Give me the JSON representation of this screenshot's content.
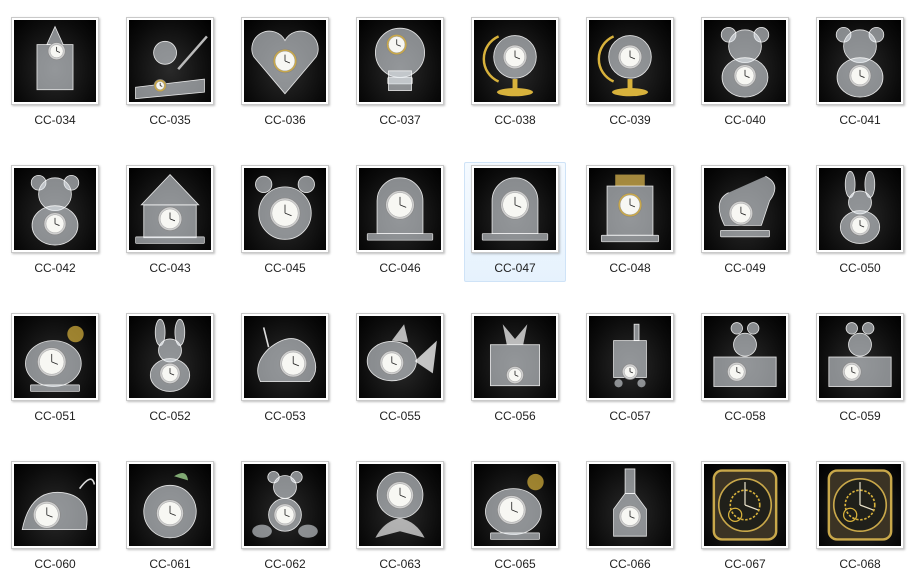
{
  "items": [
    {
      "label": "CC-034",
      "icon": "star-crystal-clock"
    },
    {
      "label": "CC-035",
      "icon": "pen-stand-clock"
    },
    {
      "label": "CC-036",
      "icon": "heart-crystal-clock"
    },
    {
      "label": "CC-037",
      "icon": "disc-crystal-clock"
    },
    {
      "label": "CC-038",
      "icon": "globe-stand-clock"
    },
    {
      "label": "CC-039",
      "icon": "globe-stand-clock"
    },
    {
      "label": "CC-040",
      "icon": "bear-crystal-clock"
    },
    {
      "label": "CC-041",
      "icon": "bear-crystal-clock"
    },
    {
      "label": "CC-042",
      "icon": "bear-crystal-clock"
    },
    {
      "label": "CC-043",
      "icon": "house-crystal-clock"
    },
    {
      "label": "CC-045",
      "icon": "alarm-crystal-clock"
    },
    {
      "label": "CC-046",
      "icon": "arch-crystal-clock"
    },
    {
      "label": "CC-047",
      "icon": "arch-crystal-clock"
    },
    {
      "label": "CC-048",
      "icon": "tower-crystal-clock"
    },
    {
      "label": "CC-049",
      "icon": "swan-crystal-clock"
    },
    {
      "label": "CC-050",
      "icon": "rabbit-crystal-clock"
    },
    {
      "label": "CC-051",
      "icon": "bird-crystal-clock"
    },
    {
      "label": "CC-052",
      "icon": "rabbit-crystal-clock"
    },
    {
      "label": "CC-053",
      "icon": "snail-crystal-clock"
    },
    {
      "label": "CC-055",
      "icon": "fish-crystal-clock"
    },
    {
      "label": "CC-056",
      "icon": "gift-crystal-clock"
    },
    {
      "label": "CC-057",
      "icon": "train-crystal-clock"
    },
    {
      "label": "CC-058",
      "icon": "mouse-block-clock"
    },
    {
      "label": "CC-059",
      "icon": "mouse-block-clock"
    },
    {
      "label": "CC-060",
      "icon": "mouse-crystal-clock"
    },
    {
      "label": "CC-061",
      "icon": "apple-crystal-clock"
    },
    {
      "label": "CC-062",
      "icon": "bear-car-clock"
    },
    {
      "label": "CC-063",
      "icon": "flower-crystal-clock"
    },
    {
      "label": "CC-065",
      "icon": "bird-crystal-clock"
    },
    {
      "label": "CC-066",
      "icon": "bottle-crystal-clock"
    },
    {
      "label": "CC-067",
      "icon": "skeleton-clock"
    },
    {
      "label": "CC-068",
      "icon": "skeleton-clock"
    }
  ],
  "selected_label": "CC-047",
  "colors": {
    "selection_bg": "#e6f2fd",
    "selection_border": "#cfe3f7",
    "thumb_bg": "#000000"
  }
}
